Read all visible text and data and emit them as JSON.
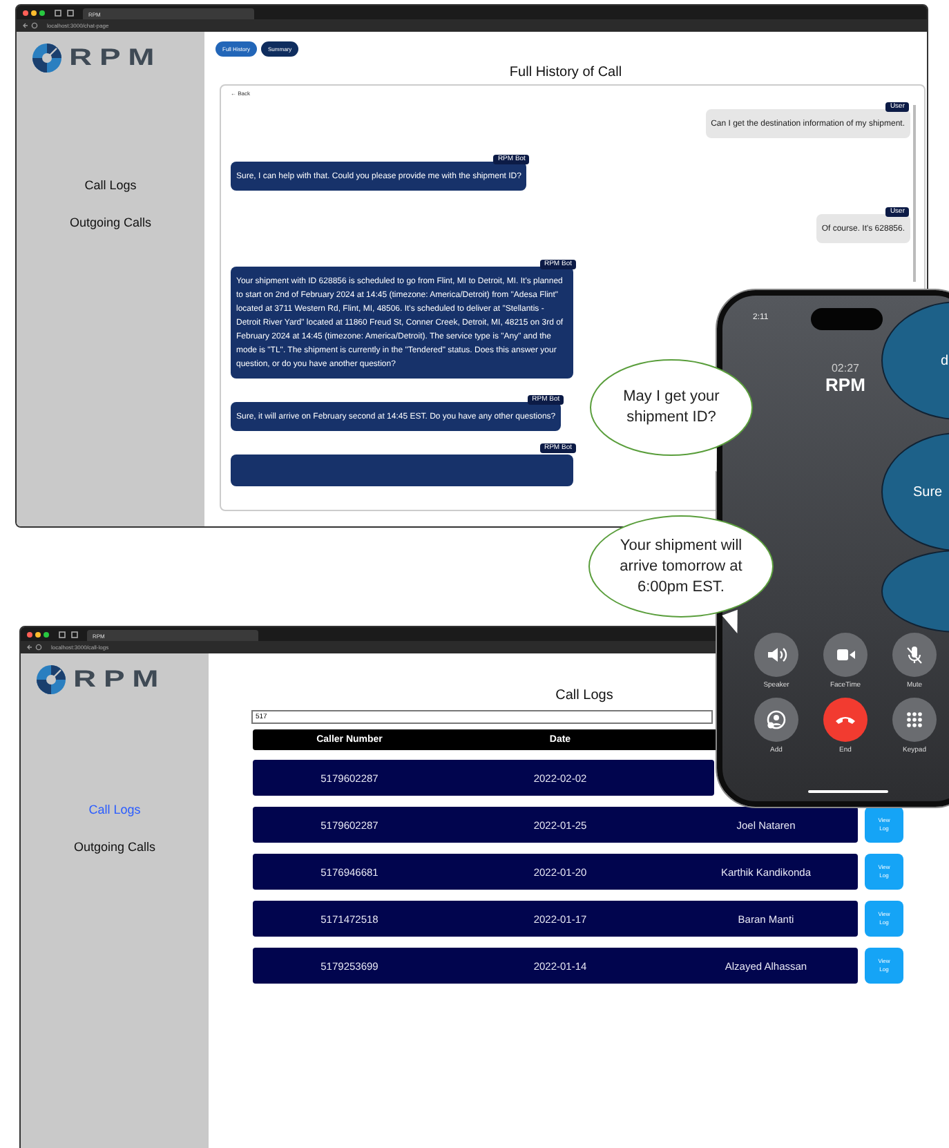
{
  "windows": [
    {
      "kind": "chat",
      "browser": {
        "tab_title": "RPM",
        "address": "localhost:3000/chat-page"
      },
      "logo": "RPM",
      "sidebar": {
        "items": [
          {
            "label": "Call Logs",
            "selected": false
          },
          {
            "label": "Outgoing Calls",
            "selected": false
          }
        ]
      },
      "tabs": [
        {
          "label": "Full History",
          "selected": true
        },
        {
          "label": "Summary",
          "selected": false
        }
      ],
      "title": "Full History of Call",
      "back": "← Back",
      "messages": [
        {
          "kind": "user",
          "sender": "User",
          "text": "Can I get the destination information of my shipment."
        },
        {
          "kind": "bot",
          "sender": "RPM Bot",
          "text": "Sure, I can help with that. Could you please provide me with the shipment ID?"
        },
        {
          "kind": "user",
          "sender": "User",
          "text": "Of course. It's 628856."
        },
        {
          "kind": "bot",
          "sender": "RPM Bot",
          "text": "Your shipment with ID 628856 is scheduled to go from Flint, MI to Detroit, MI. It's planned to start on 2nd of February 2024 at 14:45 (timezone: America/Detroit) from \"Adesa Flint\" located at 3711 Western Rd, Flint, MI, 48506. It's scheduled to deliver at \"Stellantis - Detroit River Yard\" located at 11860 Freud St, Conner Creek, Detroit, MI, 48215 on 3rd of February 2024 at 14:45 (timezone: America/Detroit). The service type is \"Any\" and the mode is \"TL\". The shipment is currently in the \"Tendered\" status. Does this answer your question, or do you have another question?"
        },
        {
          "kind": "bot",
          "sender": "RPM Bot",
          "text": "Sure, it will arrive on February second at 14:45 EST. Do you have any other questions?"
        },
        {
          "kind": "bot",
          "sender": "RPM Bot"
        }
      ]
    },
    {
      "kind": "logs",
      "browser": {
        "tab_title": "RPM",
        "address": "localhost:3000/call-logs"
      },
      "logo": "RPM",
      "sidebar": {
        "items": [
          {
            "label": "Call Logs",
            "selected": true
          },
          {
            "label": "Outgoing Calls",
            "selected": false
          }
        ]
      },
      "title": "Call Logs",
      "search": {
        "value": "517"
      },
      "columns": [
        "Caller Number",
        "Date"
      ],
      "rows": [
        {
          "cells": [
            "5179602287",
            "2022-02-02"
          ]
        },
        {
          "cells": [
            "5179602287",
            "2022-01-25",
            "Joel Nataren"
          ],
          "action": "View Log"
        },
        {
          "cells": [
            "5176946681",
            "2022-01-20",
            "Karthik Kandikonda"
          ],
          "action": "View Log"
        },
        {
          "cells": [
            "5171472518",
            "2022-01-17",
            "Baran Manti"
          ],
          "action": "View Log"
        },
        {
          "cells": [
            "5179253699",
            "2022-01-14",
            "Alzayed Alhassan"
          ],
          "action": "View Log"
        }
      ]
    }
  ],
  "phone": {
    "clock": "2:11",
    "duration": "02:27",
    "caller": "RPM",
    "controls": [
      {
        "kind": "speaker",
        "label": "Speaker"
      },
      {
        "kind": "facetime",
        "label": "FaceTime"
      },
      {
        "kind": "mute",
        "label": "Mute"
      },
      {
        "kind": "add",
        "label": "Add"
      },
      {
        "kind": "end",
        "label": "End"
      },
      {
        "kind": "keypad",
        "label": "Keypad"
      }
    ]
  },
  "caller_bubbles": [
    {
      "text": "May I get your shipment ID?"
    },
    {
      "text": "Your shipment will arrive tomorrow at 6:00pm EST."
    }
  ],
  "agent_bubbles": [
    {
      "text": "d"
    },
    {
      "text": "Sure"
    }
  ]
}
